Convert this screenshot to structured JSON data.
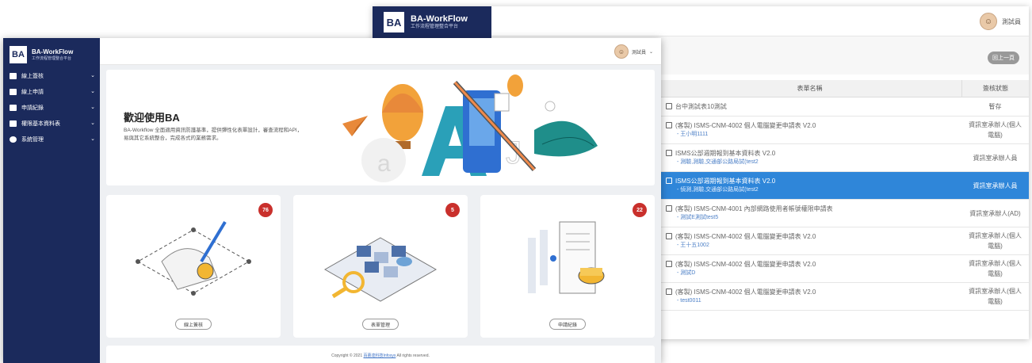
{
  "app": {
    "name": "BA-WorkFlow",
    "subtitle": "工作流程管理整合平台",
    "logo_text": "BA"
  },
  "user": {
    "name": "測試員"
  },
  "back_window": {
    "prev_button": "回上一頁",
    "table": {
      "headers": [
        "表單名稱",
        "簽核狀態"
      ],
      "rows": [
        {
          "name": "台中測試表10測試",
          "sub": "",
          "status": "暫存"
        },
        {
          "name": "(客製) ISMS-CNM-4002 個人電腦變更申請表 V2.0",
          "sub": "- 王小明1111",
          "status": "資訊室承辦人(個人電腦)"
        },
        {
          "name": "ISMS公部週期報到基本資料表 V2.0",
          "sub": "- 測驗,測驗,交通部公路局試(test2",
          "status": "資訊室承辦人員"
        },
        {
          "name": "ISMS公部週期報到基本資料表 V2.0",
          "sub": "- 偵測,測驗,交通部公路局試(test2",
          "status": "資訊室承辦人員",
          "selected": true
        },
        {
          "name": "(客製) ISMS-CNM-4001 內部網路使用者帳號權限申請表",
          "sub": "- 測試E測試test5",
          "status": "資訊室承辦人(AD)"
        },
        {
          "name": "(客製) ISMS-CNM-4002 個人電腦變更申請表 V2.0",
          "sub": "- 王十五1002",
          "status": "資訊室承辦人(個人電腦)"
        },
        {
          "name": "(客製) ISMS-CNM-4002 個人電腦變更申請表 V2.0",
          "sub": "- 測試D",
          "status": "資訊室承辦人(個人電腦)"
        },
        {
          "name": "(客製) ISMS-CNM-4002 個人電腦變更申請表 V2.0",
          "sub": "- test0011",
          "status": "資訊室承辦人(個人電腦)"
        }
      ]
    }
  },
  "front_window": {
    "menu": [
      {
        "label": "線上簽核"
      },
      {
        "label": "線上申請"
      },
      {
        "label": "申請紀錄"
      },
      {
        "label": "權限基本資料表"
      },
      {
        "label": "系統管理"
      }
    ],
    "welcome": {
      "title": "歡迎使用BA",
      "text": "BA-Workflow 全面適用資訊防護基準，提供彈性化表單設計，審查流程和API，易與其它系統整合，完成各式的業務需求。"
    },
    "cards": [
      {
        "button": "線上簽核",
        "count": "76"
      },
      {
        "button": "表單管理",
        "count": "5"
      },
      {
        "button": "申請紀錄",
        "count": "22"
      }
    ],
    "footer": {
      "prefix": "Copyright © 2021 ",
      "link": "百慕達科技Infosys",
      "suffix": " All rights reserved."
    }
  },
  "colors": {
    "sidebar": "#1b2a5c",
    "selected_row": "#2f86d9",
    "badge": "#c9302c"
  }
}
